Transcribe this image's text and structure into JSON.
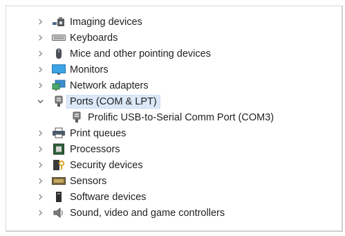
{
  "tree": {
    "items": [
      {
        "label": "Imaging devices",
        "icon": "imaging-devices-icon",
        "expanded": false
      },
      {
        "label": "Keyboards",
        "icon": "keyboard-icon",
        "expanded": false
      },
      {
        "label": "Mice and other pointing devices",
        "icon": "mouse-icon",
        "expanded": false
      },
      {
        "label": "Monitors",
        "icon": "monitor-icon",
        "expanded": false
      },
      {
        "label": "Network adapters",
        "icon": "network-adapter-icon",
        "expanded": false
      },
      {
        "label": "Ports (COM & LPT)",
        "icon": "port-icon",
        "expanded": true,
        "selected": true,
        "children": [
          {
            "label": "Prolific USB-to-Serial Comm Port (COM3)",
            "icon": "port-icon"
          }
        ]
      },
      {
        "label": "Print queues",
        "icon": "printer-icon",
        "expanded": false
      },
      {
        "label": "Processors",
        "icon": "processor-icon",
        "expanded": false
      },
      {
        "label": "Security devices",
        "icon": "security-device-icon",
        "expanded": false
      },
      {
        "label": "Sensors",
        "icon": "sensor-icon",
        "expanded": false
      },
      {
        "label": "Software devices",
        "icon": "software-device-icon",
        "expanded": false
      },
      {
        "label": "Sound, video and game controllers",
        "icon": "speaker-icon",
        "expanded": false
      }
    ]
  },
  "colors": {
    "selection": "#dbe8f7",
    "text": "#1f1f1f",
    "chevron": "#7a7a7a"
  }
}
